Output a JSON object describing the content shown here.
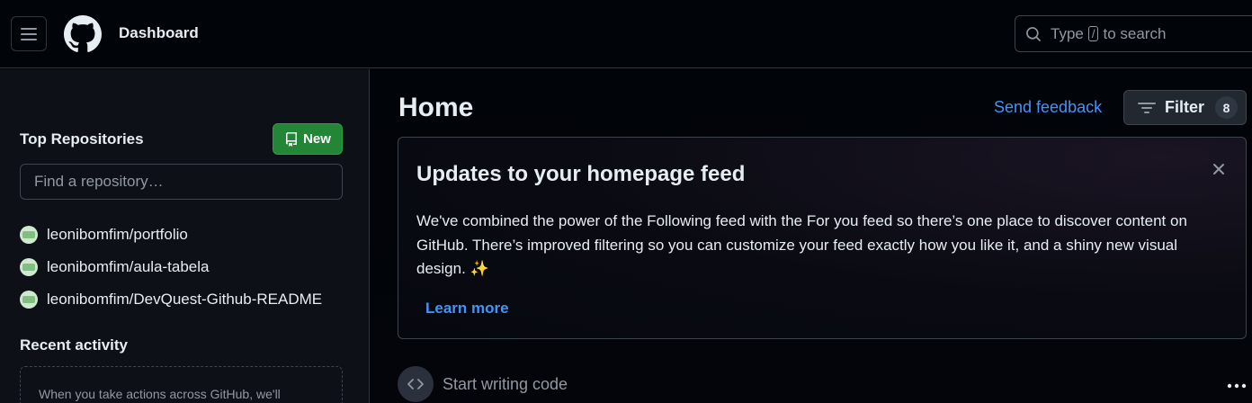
{
  "header": {
    "title": "Dashboard",
    "search": {
      "prefix": "Type",
      "key": "/",
      "suffix": "to search"
    }
  },
  "sidebar": {
    "top_repos_title": "Top Repositories",
    "new_button": "New",
    "find_placeholder": "Find a repository…",
    "repos": [
      "leonibomfim/portfolio",
      "leonibomfim/aula-tabela",
      "leonibomfim/DevQuest-Github-README"
    ],
    "recent_title": "Recent activity",
    "recent_text": "When you take actions across GitHub, we'll"
  },
  "main": {
    "title": "Home",
    "send_feedback": "Send feedback",
    "filter_label": "Filter",
    "filter_count": "8",
    "card": {
      "title": "Updates to your homepage feed",
      "body": "We've combined the power of the Following feed with the For you feed so there’s one place to discover content on GitHub. There’s improved filtering so you can customize your feed exactly how you like it, and a shiny new visual design. ✨",
      "learn_more": "Learn more"
    },
    "start_writing": "Start writing code"
  },
  "colors": {
    "background": "#010409",
    "sidebar_bg": "#0d1117",
    "accent_link": "#4493f8",
    "new_button_green": "#238636",
    "border": "#30363d"
  },
  "icons": {
    "menu": "hamburger-icon",
    "logo": "github-logo-icon",
    "search": "search-icon",
    "new": "repo-icon",
    "filter": "filter-icon",
    "close": "close-icon",
    "code": "code-icon",
    "more": "kebab-horizontal-icon"
  }
}
